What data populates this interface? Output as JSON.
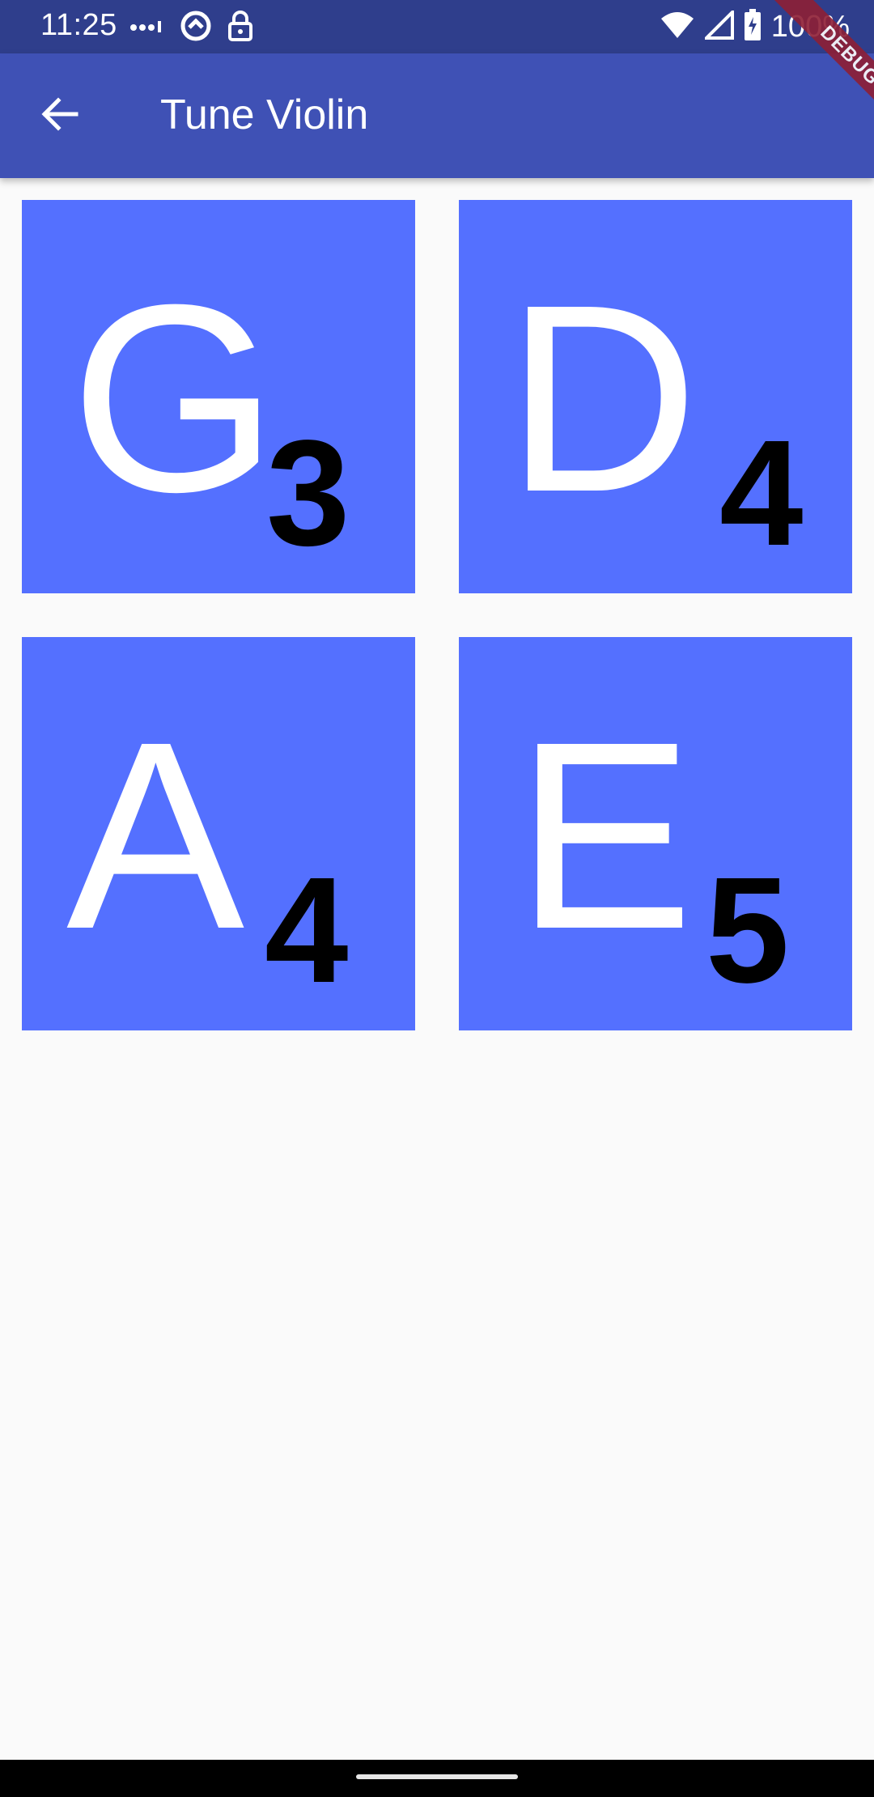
{
  "status_bar": {
    "time": "11:25",
    "battery": "100%",
    "icons": [
      "dots-icon",
      "sync-icon",
      "lock-icon",
      "wifi-icon",
      "signal-icon",
      "battery-icon"
    ]
  },
  "app_bar": {
    "title": "Tune Violin",
    "back_icon": "arrow-back-icon"
  },
  "debug_banner": "DEBUG",
  "strings": [
    {
      "note": "G",
      "octave": "3"
    },
    {
      "note": "D",
      "octave": "4"
    },
    {
      "note": "A",
      "octave": "4"
    },
    {
      "note": "E",
      "octave": "5"
    }
  ],
  "colors": {
    "status_bar": "#2f3e8c",
    "app_bar": "#3f51b5",
    "tile": "#5470ff",
    "background": "#fafafa"
  }
}
